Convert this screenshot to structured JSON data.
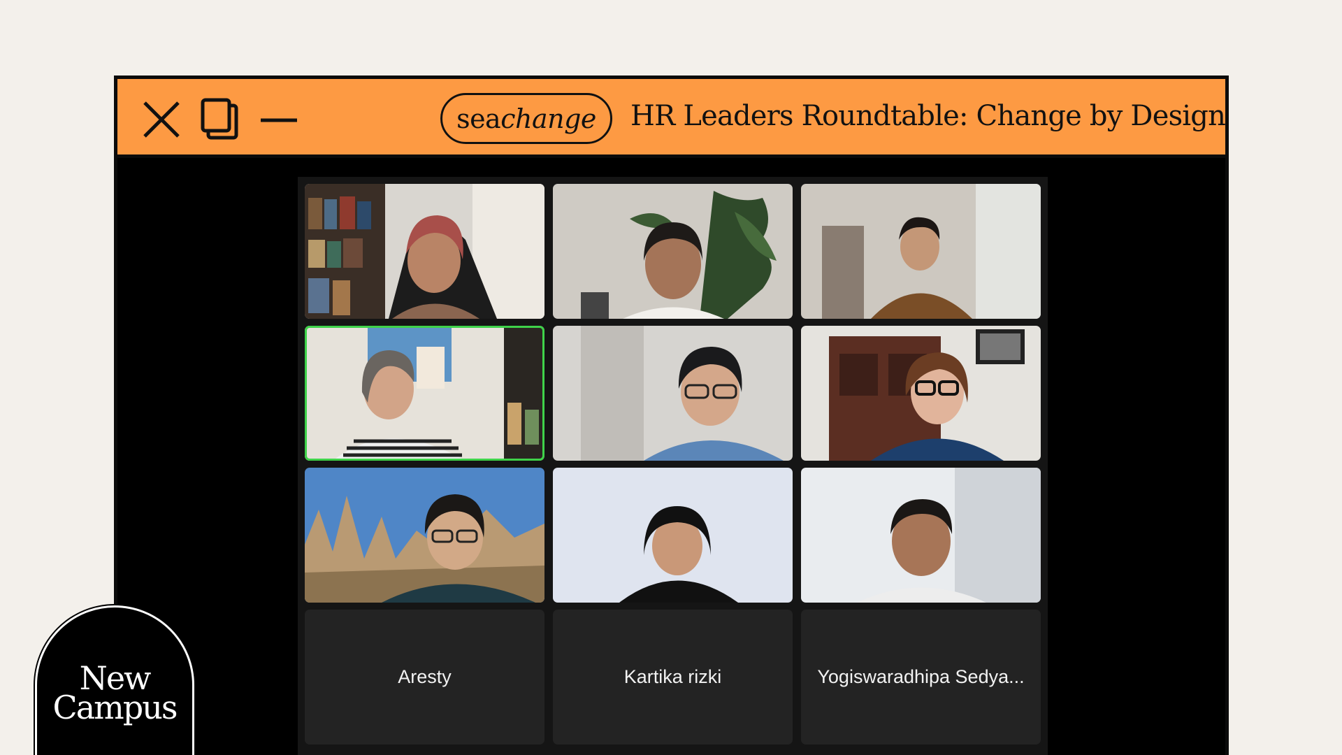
{
  "window": {
    "brand": {
      "part1": "sea",
      "part2": "change"
    },
    "title": "HR Leaders Roundtable: Change by Design"
  },
  "participants": [
    {
      "id": 1,
      "video": true,
      "speaking": false,
      "scene": "bookshelf-headset"
    },
    {
      "id": 2,
      "video": true,
      "speaking": false,
      "scene": "plant-wall"
    },
    {
      "id": 3,
      "video": true,
      "speaking": false,
      "scene": "blurred-room"
    },
    {
      "id": 4,
      "video": true,
      "speaking": true,
      "scene": "map-wall"
    },
    {
      "id": 5,
      "video": true,
      "speaking": false,
      "scene": "blurred-white"
    },
    {
      "id": 6,
      "video": true,
      "speaking": false,
      "scene": "wooden-cabinet"
    },
    {
      "id": 7,
      "video": true,
      "speaking": false,
      "scene": "rock-landscape"
    },
    {
      "id": 8,
      "video": true,
      "speaking": false,
      "scene": "light-blue-wall"
    },
    {
      "id": 9,
      "video": true,
      "speaking": false,
      "scene": "bright-office"
    },
    {
      "id": 10,
      "video": false,
      "name": "Aresty"
    },
    {
      "id": 11,
      "video": false,
      "name": "Kartika rizki"
    },
    {
      "id": 12,
      "video": false,
      "name": "Yogiswaradhipa Sedya..."
    }
  ],
  "logo": {
    "line1": "New",
    "line2": "Campus"
  },
  "colors": {
    "titlebar": "#fd9a43",
    "background": "#f3f0eb",
    "speaking_border": "#3fd24a",
    "tile_dark": "#232323"
  }
}
